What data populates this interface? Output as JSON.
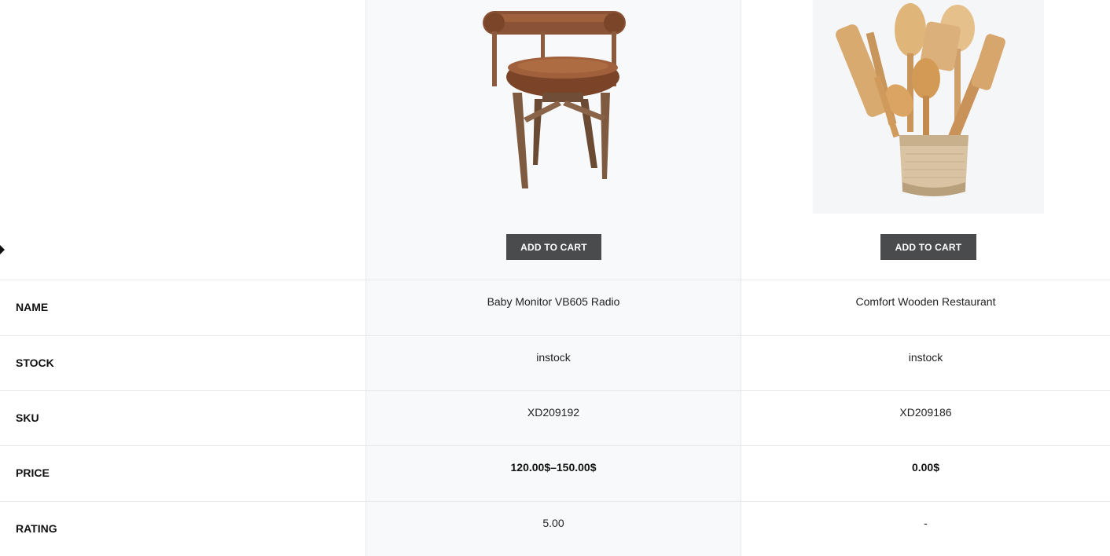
{
  "products": [
    {
      "image_alt": "brown leather swivel chair with wooden legs",
      "add_to_cart_label": "ADD TO CART",
      "name": "Baby Monitor VB605 Radio",
      "stock": "instock",
      "sku": "XD209192",
      "price": "120.00$–150.00$",
      "rating": "5.00"
    },
    {
      "image_alt": "wooden kitchen utensils in burlap pot",
      "add_to_cart_label": "ADD TO CART",
      "name": "Comfort Wooden Restaurant",
      "stock": "instock",
      "sku": "XD209186",
      "price": "0.00$",
      "rating": "-"
    }
  ],
  "row_labels": {
    "name": "NAME",
    "stock": "STOCK",
    "sku": "SKU",
    "price": "PRICE",
    "rating": "RATING"
  },
  "colors": {
    "button_bg": "#4a4b4d",
    "column_bg": "#f8f9fa",
    "border": "#e6e8ea"
  }
}
